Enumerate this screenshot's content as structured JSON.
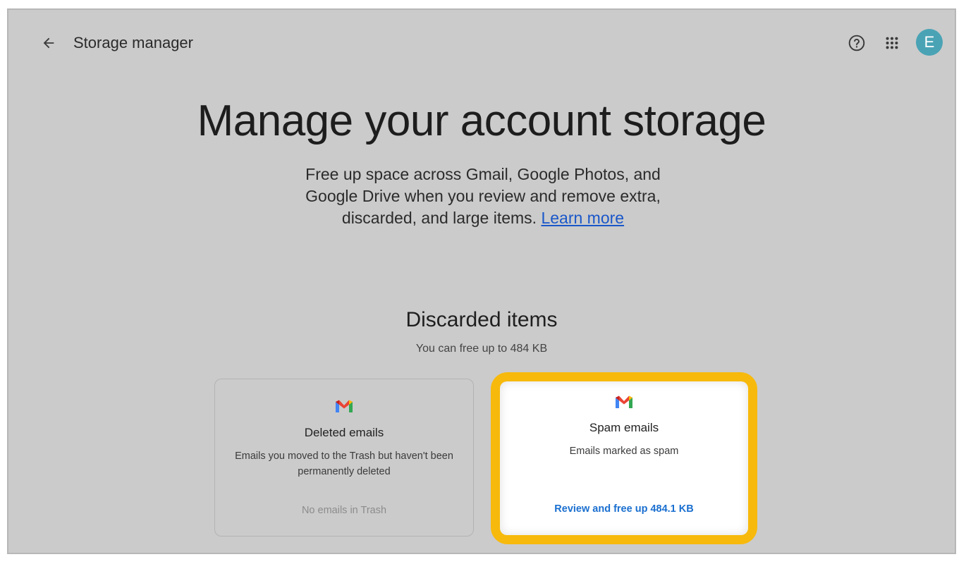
{
  "header": {
    "title": "Storage manager",
    "avatar_letter": "E"
  },
  "hero": {
    "headline": "Manage your account storage",
    "description": "Free up space across Gmail, Google Photos, and Google Drive when you review and remove extra, discarded, and large items.",
    "learn_more": "Learn more"
  },
  "discarded": {
    "title": "Discarded items",
    "subtitle": "You can free up to  484 KB",
    "cards": [
      {
        "title": "Deleted emails",
        "description": "Emails you moved to the Trash but haven't been permanently deleted",
        "status": "No emails in Trash"
      },
      {
        "title": "Spam emails",
        "description": "Emails marked as spam",
        "action": "Review and free up 484.1 KB"
      }
    ]
  },
  "colors": {
    "highlight": "#f7b90c",
    "link": "#1a57c9",
    "avatar": "#4aa3b5"
  }
}
